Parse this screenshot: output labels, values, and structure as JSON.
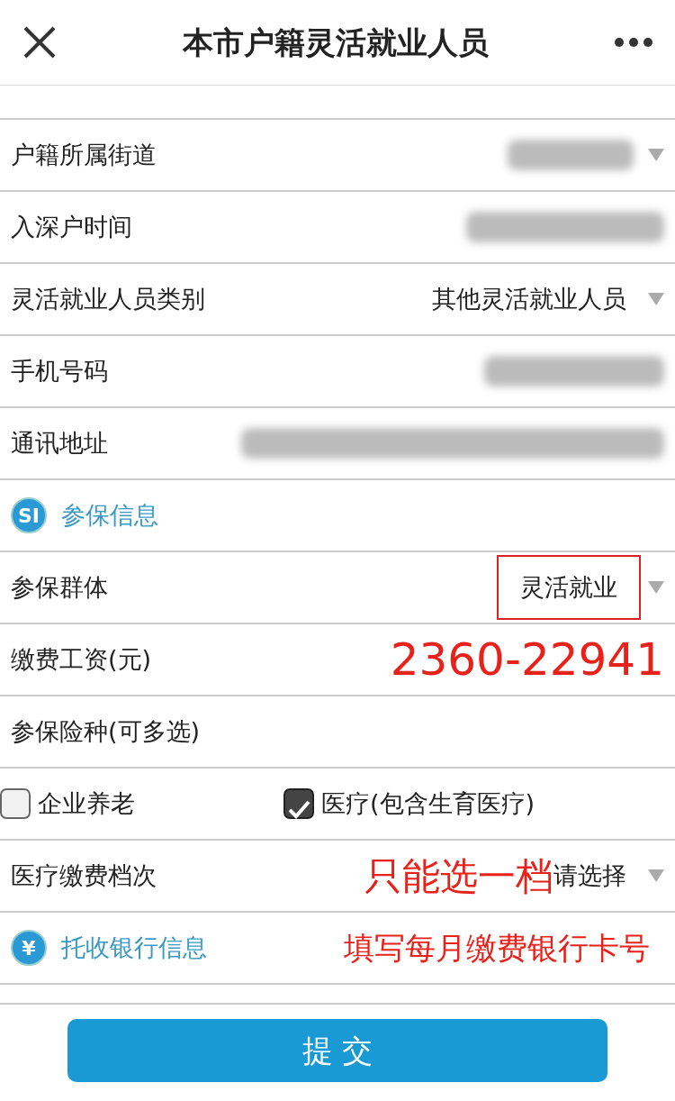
{
  "header": {
    "title": "本市户籍灵活就业人员"
  },
  "rows": [
    {
      "kind": "select",
      "label": "户籍所属街道",
      "masked": true
    },
    {
      "kind": "input",
      "label": "入深户时间",
      "masked": true
    },
    {
      "kind": "select",
      "label": "灵活就业人员类别",
      "value": "其他灵活就业人员"
    },
    {
      "kind": "input",
      "label": "手机号码",
      "masked": true
    },
    {
      "kind": "input",
      "label": "通讯地址",
      "masked": true
    },
    {
      "kind": "section",
      "icon_text": "SI",
      "label": "参保信息"
    },
    {
      "kind": "select",
      "label": "参保群体",
      "value": "灵活就业",
      "highlighted": true
    },
    {
      "kind": "input",
      "label": "缴费工资(元)",
      "note": "2360-22941"
    },
    {
      "kind": "input",
      "label": "参保险种(可多选)"
    },
    {
      "kind": "checks",
      "options": [
        {
          "label": "企业养老",
          "checked": false
        },
        {
          "label": "医疗(包含生育医疗)",
          "checked": true
        }
      ]
    },
    {
      "kind": "select",
      "label": "医疗缴费档次",
      "note": "只能选一档",
      "placeholder": "请选择"
    },
    {
      "kind": "section",
      "icon_text": "¥",
      "label": "托收银行信息",
      "note": "填写每月缴费银行卡号"
    }
  ],
  "submit": {
    "label": "提 交"
  }
}
